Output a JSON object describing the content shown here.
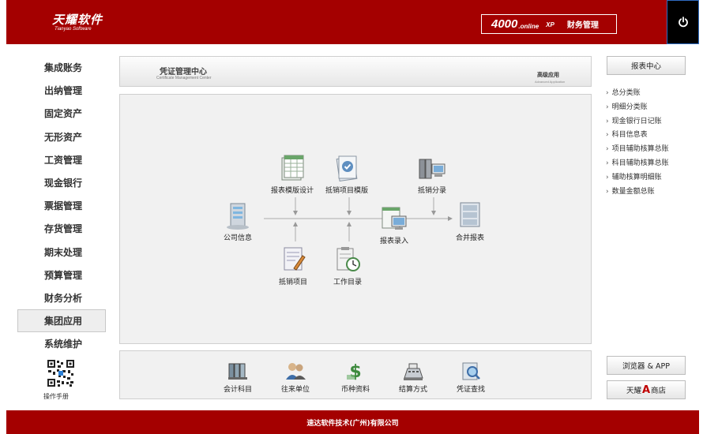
{
  "header": {
    "logo_main": "天耀软件",
    "logo_sub": "Tianyao Software",
    "product_4000": "4000",
    "product_online": ".online",
    "product_xp": "XP",
    "product_name": "财务管理",
    "power_icon": "power-icon"
  },
  "nav": {
    "items": [
      {
        "label": "集成账务"
      },
      {
        "label": "出纳管理"
      },
      {
        "label": "固定资产"
      },
      {
        "label": "无形资产"
      },
      {
        "label": "工资管理"
      },
      {
        "label": "现金银行"
      },
      {
        "label": "票据管理"
      },
      {
        "label": "存货管理"
      },
      {
        "label": "期末处理"
      },
      {
        "label": "预算管理"
      },
      {
        "label": "财务分析"
      },
      {
        "label": "集团应用",
        "active": true
      },
      {
        "label": "系统维护"
      }
    ],
    "manual_label": "操作手册"
  },
  "banner": {
    "title": "凭证管理中心",
    "subtitle": "Certificate Management Center",
    "advanced": "高级应用",
    "advanced_sub": "Advanced Application"
  },
  "flow": {
    "nodes": {
      "company_info": "公司信息",
      "report_template_design": "报表模版设计",
      "offset_item_template": "抵销项目模版",
      "offset_allocation": "抵销分录",
      "report_entry": "报表录入",
      "consolidated_report": "合并报表",
      "offset_items": "抵销项目",
      "work_directory": "工作目录"
    }
  },
  "toolbar": {
    "items": [
      {
        "label": "会计科目",
        "icon": "ledger-icon"
      },
      {
        "label": "往来单位",
        "icon": "contacts-icon"
      },
      {
        "label": "币种资料",
        "icon": "currency-icon"
      },
      {
        "label": "结算方式",
        "icon": "cash-register-icon"
      },
      {
        "label": "凭证查找",
        "icon": "search-document-icon"
      }
    ]
  },
  "right": {
    "report_center": "报表中心",
    "links": [
      "总分类账",
      "明细分类账",
      "现金银行日记账",
      "科目信息表",
      "项目辅助核算总账",
      "科目辅助核算总账",
      "辅助核算明细账",
      "数量金额总账"
    ],
    "browser_app": "浏览器 & APP",
    "store_prefix": "天耀",
    "store_a": "A",
    "store_suffix": "商店"
  },
  "footer": {
    "company": "速达软件技术(广州)有限公司"
  },
  "colors": {
    "brand_red": "#a40000",
    "store_a": "#c00000"
  }
}
